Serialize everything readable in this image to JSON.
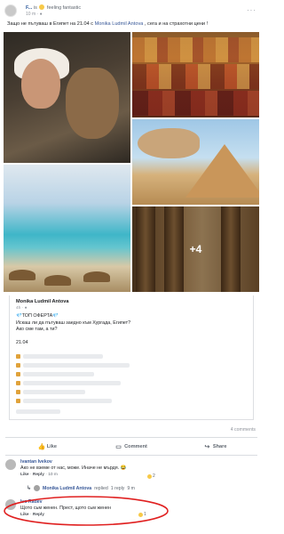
{
  "post": {
    "author": "F...",
    "feeling_text": "is",
    "feeling_label": "feeling fantastic",
    "time": "10 m",
    "privacy_icon": "globe-icon",
    "text_before": "Защо не пътуваш в Египет на 21.04 с",
    "text_mention": "Monika Ludmil Antova",
    "text_after": ", сега и на страхотни цени !",
    "more_photos": "+4"
  },
  "shared": {
    "author": "Monika Ludmil Antova",
    "time": "4h",
    "lines": [
      "💎ТОП ОФЕРТА💎",
      "Искаш ли да пътуваш заедно към Хургада, Египет?",
      "Ако сме там, а ти?",
      "",
      "21.04",
      "",
      "💗"
    ]
  },
  "stats": {
    "comments_count": "4 comments"
  },
  "actions": {
    "like": "Like",
    "comment": "Comment",
    "share": "Share"
  },
  "comments": [
    {
      "name": "Ivantan Ivekov",
      "text": "Ако не вземе от нас, може. Иначе не мърдя. 😂",
      "like": "Like",
      "reply": "Reply",
      "time": "10 m",
      "reaction_count": "2"
    },
    {
      "name": "Ivo Radev",
      "text": "Щото сьм женен. Прест, щото сьм женен",
      "like": "Like",
      "reply": "Reply",
      "time": "",
      "reaction_count": "1"
    }
  ],
  "reply_summary": {
    "name": "Monika Ludmil Antova",
    "text": "replied",
    "count": "1 reply",
    "time": "9 m"
  },
  "colors": {
    "link": "#385898",
    "annotation_red": "#e02020"
  }
}
